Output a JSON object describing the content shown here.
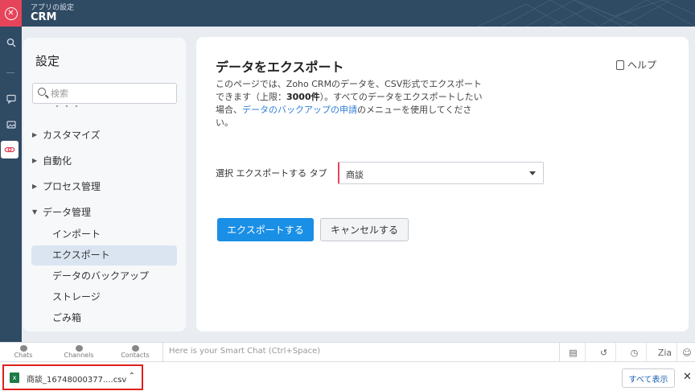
{
  "app": {
    "subtitle": "アプリの設定",
    "title": "CRM"
  },
  "rail": {
    "icons": [
      "close-icon",
      "search-icon",
      "chat-icon",
      "image-icon",
      "link-icon"
    ]
  },
  "settings": {
    "heading": "設定",
    "search_placeholder": "検索",
    "nav": [
      {
        "label": "カスタマイズ",
        "expanded": false
      },
      {
        "label": "自動化",
        "expanded": false
      },
      {
        "label": "プロセス管理",
        "expanded": false
      },
      {
        "label": "データ管理",
        "expanded": true
      }
    ],
    "sub_items": [
      {
        "label": "インポート"
      },
      {
        "label": "エクスポート",
        "active": true
      },
      {
        "label": "データのバックアップ"
      },
      {
        "label": "ストレージ"
      },
      {
        "label": "ごみ箱"
      }
    ]
  },
  "main": {
    "title": "データをエクスポート",
    "help_label": "ヘルプ",
    "desc_part1": "このページでは、Zoho CRMのデータを、CSV形式でエクスポートできます（上限：",
    "desc_limit": "3000件",
    "desc_part2": "）。すべてのデータをエクスポートしたい場合、",
    "desc_link": "データのバックアップの申請",
    "desc_part3": "のメニューを使用してください。",
    "field_label": "選択 エクスポートする タブ",
    "selected_tab": "商談",
    "export_button": "エクスポートする",
    "cancel_button": "キャンセルする"
  },
  "chatbar": {
    "chats": "Chats",
    "channels": "Channels",
    "contacts": "Contacts",
    "placeholder": "Here is your Smart Chat (Ctrl+Space)"
  },
  "downloads": {
    "filename": "商談_16748000377....csv",
    "show_all": "すべて表示"
  },
  "colors": {
    "header_bg": "#2f4a63",
    "accent_red": "#e5445a",
    "primary_blue": "#1a8fe6",
    "link_blue": "#2f7fd8"
  }
}
